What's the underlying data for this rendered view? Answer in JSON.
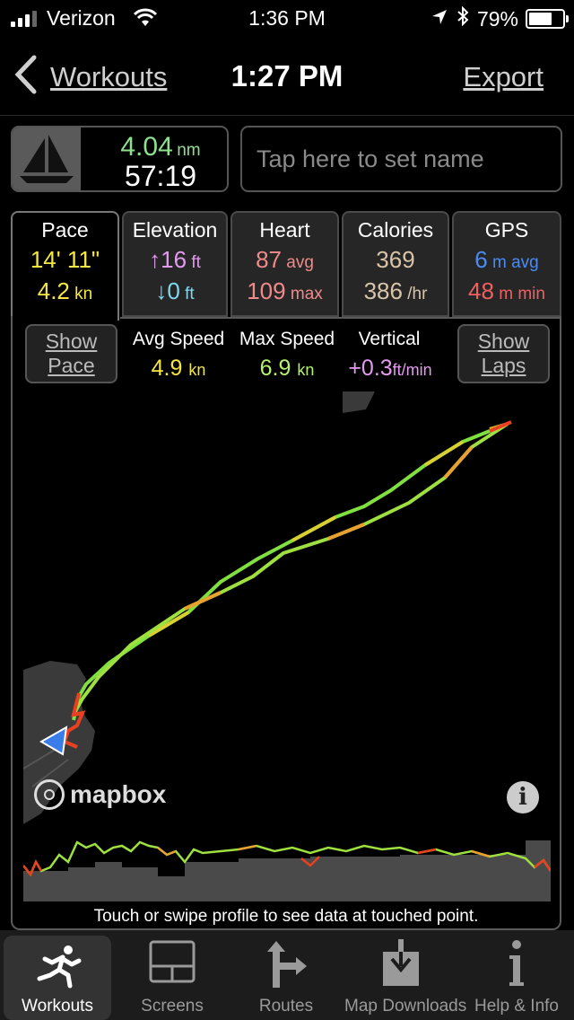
{
  "status_bar": {
    "carrier": "Verizon",
    "time": "1:36 PM",
    "battery": "79%",
    "battery_level": 0.79
  },
  "nav": {
    "back_label": "Workouts",
    "title": "1:27 PM",
    "export_label": "Export"
  },
  "summary": {
    "activity_icon": "sailboat-icon",
    "distance": "4.04",
    "distance_unit": "nm",
    "duration": "57:19",
    "name_placeholder": "Tap here to set name"
  },
  "tabs": [
    {
      "label": "Pace",
      "line1_value": "14' 11\"",
      "line1_unit": "",
      "line2_value": "4.2",
      "line2_unit": "kn",
      "line1_color": "#f5e642",
      "line2_color": "#f5e642"
    },
    {
      "label": "Elevation",
      "line1_value": "↑16",
      "line1_unit": "ft",
      "line2_value": "↓0",
      "line2_unit": "ft",
      "line1_color": "#e49af0",
      "line2_color": "#7fd8f0"
    },
    {
      "label": "Heart",
      "line1_value": "87",
      "line1_unit": "avg",
      "line2_value": "109",
      "line2_unit": "max",
      "line1_color": "#f08a8a",
      "line2_color": "#f08a8a"
    },
    {
      "label": "Calories",
      "line1_value": "369",
      "line1_unit": "",
      "line2_value": "386",
      "line2_unit": "/hr",
      "line1_color": "#d9c4a8",
      "line2_color": "#d9c4a8"
    },
    {
      "label": "GPS",
      "line1_value": "6",
      "line1_unit": "m avg",
      "line2_value": "48",
      "line2_unit": "m min",
      "line1_color": "#4a8cf0",
      "line2_color": "#f06060"
    }
  ],
  "panel": {
    "show_pace_l1": "Show",
    "show_pace_l2": "Pace",
    "show_laps_l1": "Show",
    "show_laps_l2": "Laps",
    "stats": [
      {
        "label": "Avg Speed",
        "value": "4.9",
        "unit": "kn",
        "color": "#f5e642"
      },
      {
        "label": "Max Speed",
        "value": "6.9",
        "unit": "kn",
        "color": "#b8f070"
      },
      {
        "label": "Vertical",
        "value": "+0.3",
        "unit": "ft/min",
        "color": "#e49af0"
      }
    ]
  },
  "map": {
    "attribution": "mapbox",
    "info_icon": "info-icon"
  },
  "profile": {
    "caption": "Touch or swipe profile to see data at touched point."
  },
  "tabbar": [
    {
      "label": "Workouts",
      "icon": "running-man-icon",
      "active": true
    },
    {
      "label": "Screens",
      "icon": "screens-icon",
      "active": false
    },
    {
      "label": "Routes",
      "icon": "route-sign-icon",
      "active": false
    },
    {
      "label": "Map Downloads",
      "icon": "download-box-icon",
      "active": false
    },
    {
      "label": "Help & Info",
      "icon": "info-icon",
      "active": false
    }
  ],
  "colors": {
    "background": "#000000",
    "accent_green": "#8ee08e",
    "track_green": "#7fe040",
    "track_red": "#e84020"
  }
}
